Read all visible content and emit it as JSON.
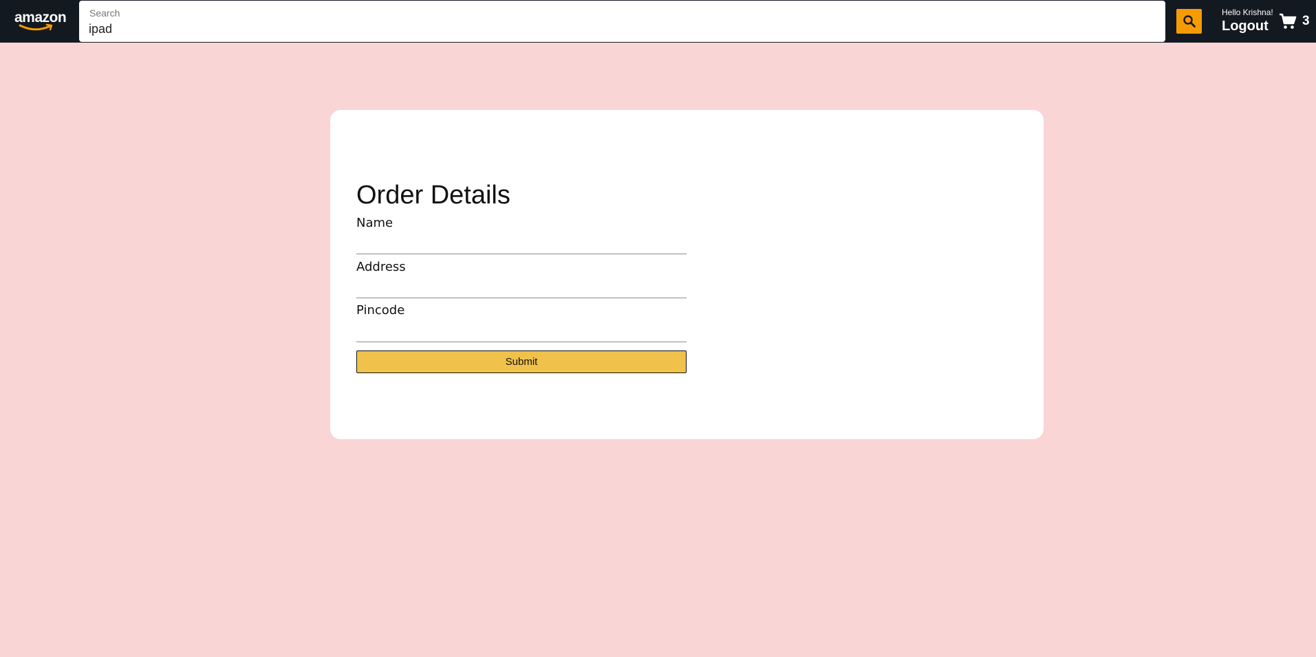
{
  "header": {
    "logo_text": "amazon",
    "search": {
      "label": "Search",
      "value": "ipad"
    },
    "search_button_icon": "search-icon",
    "greeting": "Hello Krishna!",
    "logout_label": "Logout",
    "cart_icon": "shopping-cart-icon",
    "cart_count": "3"
  },
  "form": {
    "title": "Order Details",
    "fields": [
      {
        "label": "Name",
        "value": ""
      },
      {
        "label": "Address",
        "value": ""
      },
      {
        "label": "Pincode",
        "value": ""
      }
    ],
    "submit_label": "Submit"
  },
  "colors": {
    "page_background": "#fad5d6",
    "header_background": "#131921",
    "search_button": "#f79b05",
    "submit_button": "#f0c14b",
    "logo_smile": "#f79b05"
  }
}
